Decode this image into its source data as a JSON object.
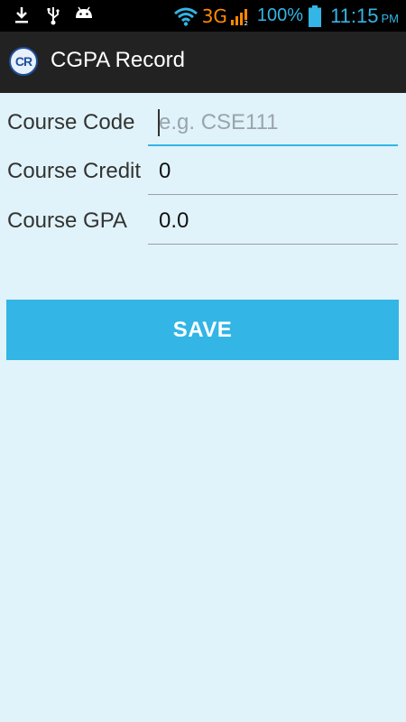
{
  "status_bar": {
    "network": "3G",
    "battery": "100%",
    "time": "11:15",
    "ampm": "PM",
    "icons": [
      "download-icon",
      "usb-icon",
      "android-icon",
      "wifi-icon",
      "signal-icon",
      "battery-icon"
    ]
  },
  "action_bar": {
    "logo_text": "CR",
    "title": "CGPA Record"
  },
  "form": {
    "course_code": {
      "label": "Course Code",
      "value": "",
      "placeholder": "e.g. CSE111"
    },
    "course_credit": {
      "label": "Course Credit",
      "value": "0"
    },
    "course_gpa": {
      "label": "Course GPA",
      "value": "0.0"
    }
  },
  "save_button": {
    "label": "SAVE"
  },
  "colors": {
    "accent": "#33b5e5",
    "background": "#e0f3fa",
    "action_bar": "#222222",
    "status_bar": "#000000",
    "network_orange": "#ff8a00"
  }
}
